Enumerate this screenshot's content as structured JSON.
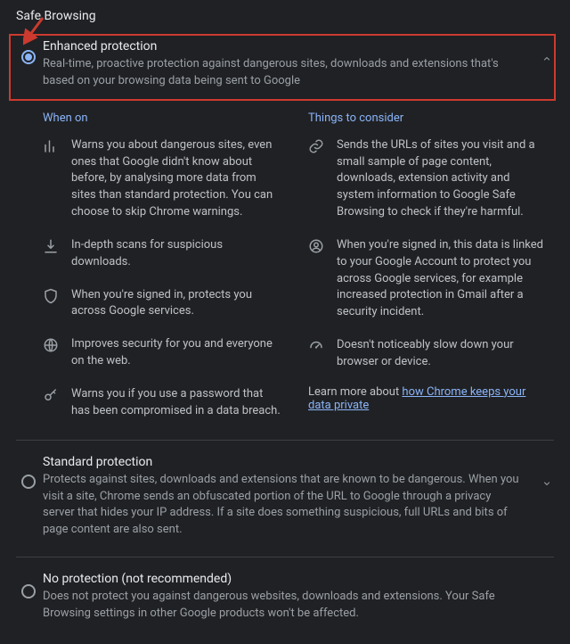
{
  "section_title": "Safe Browsing",
  "enhanced": {
    "title": "Enhanced protection",
    "desc": "Real-time, proactive protection against dangerous sites, downloads and extensions that's based on your browsing data being sent to Google",
    "when_on_header": "When on",
    "consider_header": "Things to consider",
    "when_on": [
      "Warns you about dangerous sites, even ones that Google didn't know about before, by analysing more data from sites than standard protection. You can choose to skip Chrome warnings.",
      "In-depth scans for suspicious downloads.",
      "When you're signed in, protects you across Google services.",
      "Improves security for you and everyone on the web.",
      "Warns you if you use a password that has been compromised in a data breach."
    ],
    "consider": [
      "Sends the URLs of sites you visit and a small sample of page content, downloads, extension activity and system information to Google Safe Browsing to check if they're harmful.",
      "When you're signed in, this data is linked to your Google Account to protect you across Google services, for example increased protection in Gmail after a security incident.",
      "Doesn't noticeably slow down your browser or device."
    ],
    "learn_more_prefix": "Learn more about ",
    "learn_more_link": "how Chrome keeps your data private"
  },
  "standard": {
    "title": "Standard protection",
    "desc": "Protects against sites, downloads and extensions that are known to be dangerous. When you visit a site, Chrome sends an obfuscated portion of the URL to Google through a privacy server that hides your IP address. If a site does something suspicious, full URLs and bits of page content are also sent."
  },
  "none": {
    "title": "No protection (not recommended)",
    "desc": "Does not protect you against dangerous websites, downloads and extensions. Your Safe Browsing settings in other Google products won't be affected."
  }
}
